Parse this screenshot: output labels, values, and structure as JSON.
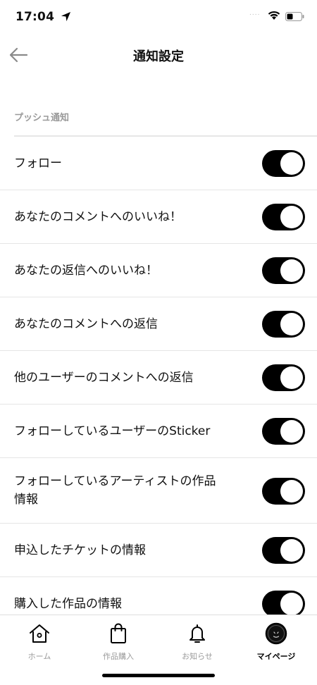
{
  "status_bar": {
    "time": "17:04",
    "signal_dots": "....",
    "icons": [
      "location-arrow-icon",
      "wifi-icon",
      "battery-icon"
    ]
  },
  "header": {
    "title": "通知設定",
    "back_icon": "back-arrow-icon"
  },
  "section": {
    "title": "プッシュ通知"
  },
  "settings": [
    {
      "label": "フォロー",
      "enabled": true
    },
    {
      "label": "あなたのコメントへのいいね！",
      "enabled": true
    },
    {
      "label": "あなたの返信へのいいね！",
      "enabled": true
    },
    {
      "label": "あなたのコメントへの返信",
      "enabled": true
    },
    {
      "label": "他のユーザーのコメントへの返信",
      "enabled": true
    },
    {
      "label": "フォローしているユーザーのSticker",
      "enabled": true
    },
    {
      "label": "フォローしているアーティストの作品\n情報",
      "enabled": true
    },
    {
      "label": "申込したチケットの情報",
      "enabled": true
    },
    {
      "label": "購入した作品の情報",
      "enabled": true
    }
  ],
  "tab_bar": {
    "tabs": [
      {
        "label": "ホーム",
        "icon": "home-icon",
        "active": false
      },
      {
        "label": "作品購入",
        "icon": "shopping-bag-icon",
        "active": false
      },
      {
        "label": "お知らせ",
        "icon": "bell-icon",
        "active": false
      },
      {
        "label": "マイページ",
        "icon": "profile-avatar-icon",
        "active": true
      }
    ]
  },
  "colors": {
    "toggle_on": "#000000",
    "section_header": "#9a9a9a",
    "divider": "#e5e5e5"
  }
}
